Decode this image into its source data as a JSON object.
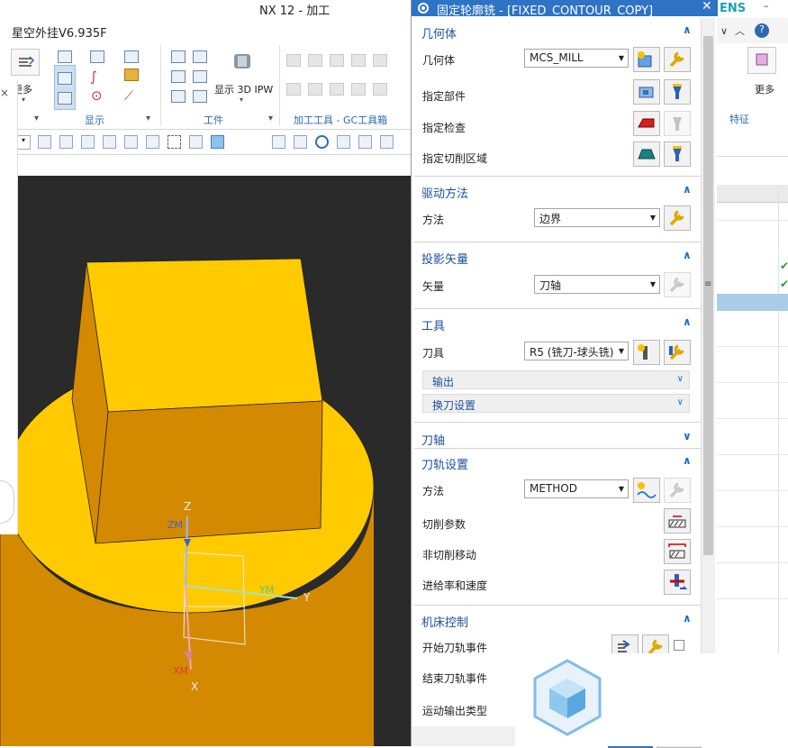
{
  "window": {
    "title": "NX 12 - 加工"
  },
  "app": {
    "name": "星空外挂V6.935F"
  },
  "ribbon": {
    "more_label": "更多",
    "display_label": "显示",
    "show_ipw_label": "显示 3D IPW",
    "workpiece_label": "工件",
    "tools_label": "加工工具 - GC工具箱",
    "right_more_label": "更多",
    "feature_label": "特征"
  },
  "brand": {
    "partial": "ENS"
  },
  "dialog": {
    "title": "固定轮廓铣 - [FIXED_CONTOUR_COPY]",
    "geometry": {
      "title": "几何体",
      "geometry_label": "几何体",
      "geometry_value": "MCS_MILL",
      "part_label": "指定部件",
      "check_label": "指定检查",
      "cut_area_label": "指定切削区域"
    },
    "drive": {
      "title": "驱动方法",
      "method_label": "方法",
      "method_value": "边界"
    },
    "projection": {
      "title": "投影矢量",
      "vector_label": "矢量",
      "vector_value": "刀轴"
    },
    "tool": {
      "title": "工具",
      "tool_label": "刀具",
      "tool_value": "R5 (铣刀-球头铣)",
      "output_label": "输出",
      "toolchange_label": "换刀设置"
    },
    "tool_axis": {
      "title": "刀轴"
    },
    "path": {
      "title": "刀轨设置",
      "method_label": "方法",
      "method_value": "METHOD",
      "cut_params_label": "切削参数",
      "non_cut_label": "非切削移动",
      "feed_label": "进给率和速度"
    },
    "machine": {
      "title": "机床控制",
      "start_event_label": "开始刀轨事件",
      "end_event_label": "结束刀轨事件",
      "motion_output_label": "运动输出类型"
    }
  },
  "viewport": {
    "axis_z": "Z",
    "axis_zm": "ZM",
    "axis_ym": "YM",
    "axis_y": "Y",
    "axis_xm": "XM",
    "axis_x": "X"
  },
  "colors": {
    "accent": "#2e73c4",
    "part_top": "#ffca00",
    "part_side": "#d48a00",
    "background": "#2a2a2a"
  }
}
